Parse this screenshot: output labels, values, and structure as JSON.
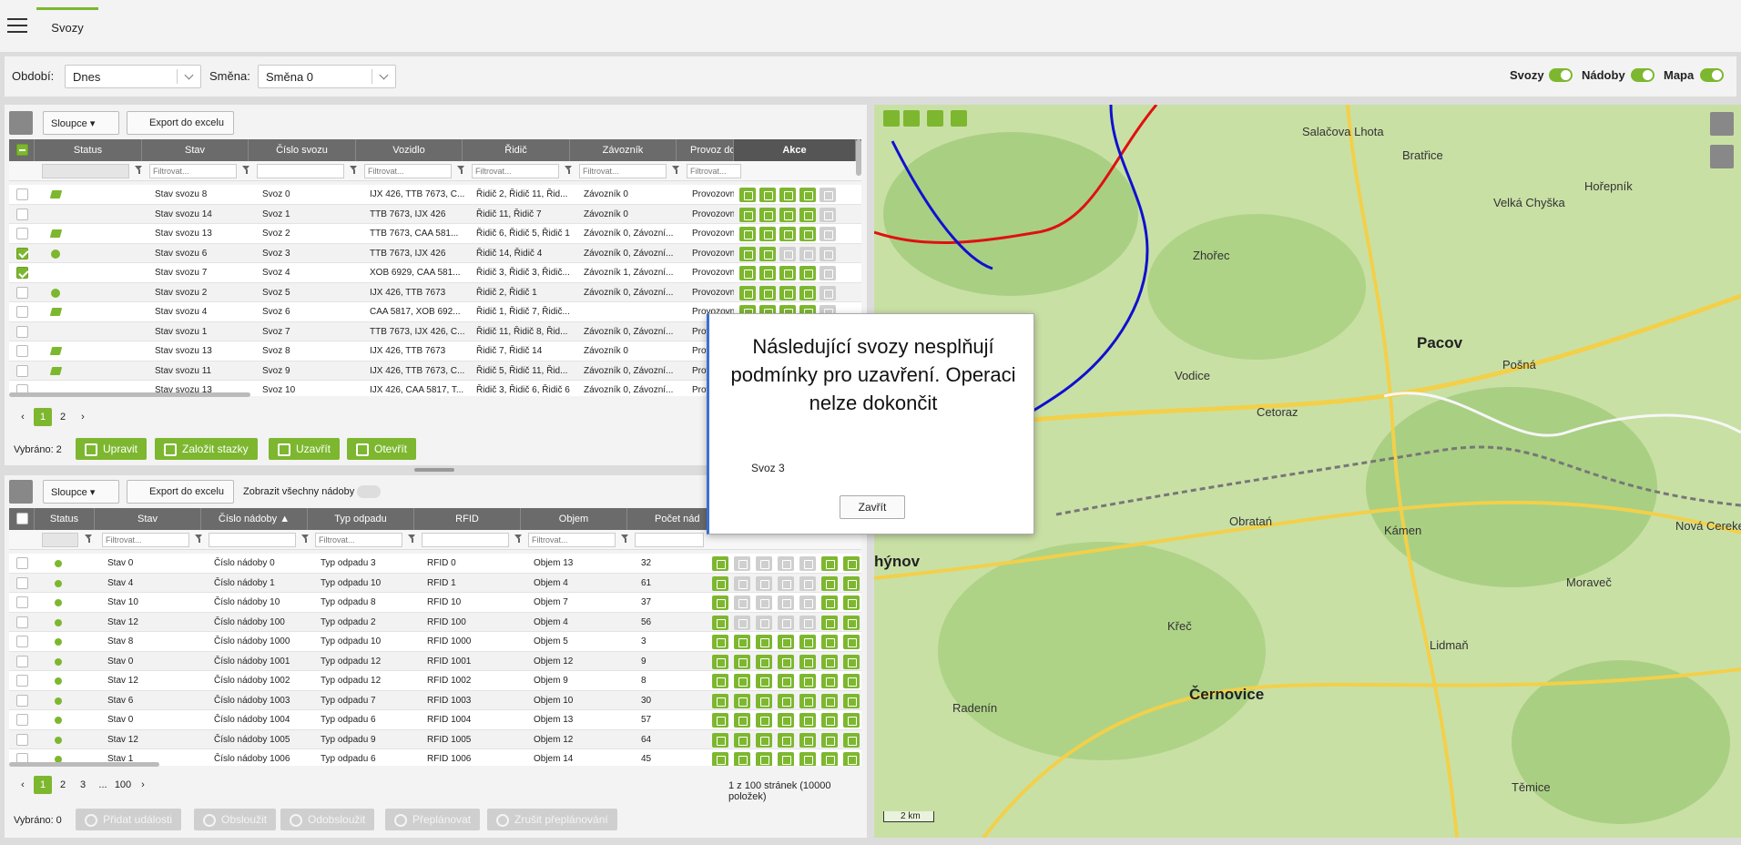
{
  "header": {
    "tab": "Svozy"
  },
  "filters": {
    "period_label": "Období:",
    "period_value": "Dnes",
    "shift_label": "Směna:",
    "shift_value": "Směna 0",
    "toggles": [
      {
        "label": "Svozy",
        "on": true
      },
      {
        "label": "Nádoby",
        "on": true
      },
      {
        "label": "Mapa",
        "on": true
      }
    ]
  },
  "top": {
    "columns_btn": "Sloupce",
    "export_btn": "Export do excelu",
    "headers": [
      "Status",
      "Stav",
      "Číslo svozu",
      "Vozidlo",
      "Řidič",
      "Závozník",
      "Provoz do",
      "Akce"
    ],
    "filter_placeholder": "Filtrovat...",
    "rows": [
      {
        "check": false,
        "icon": "truck",
        "stav": "Stav svozu 8",
        "svoz": "Svoz 0",
        "vozidlo": "IJX 426, TTB 7673, C...",
        "ridic": "Řidič 2, Řidič 11, Řid...",
        "zavoznik": "Závozník 0",
        "provoz": "Provozovna"
      },
      {
        "check": false,
        "icon": "",
        "stav": "Stav svozu 14",
        "svoz": "Svoz 1",
        "vozidlo": "TTB 7673, IJX 426",
        "ridic": "Řidič 11, Řidič 7",
        "zavoznik": "Závozník 0",
        "provoz": "Provozovna"
      },
      {
        "check": false,
        "icon": "truck",
        "stav": "Stav svozu 13",
        "svoz": "Svoz 2",
        "vozidlo": "TTB 7673, CAA 581...",
        "ridic": "Řidič 6, Řidič 5, Řidič 1",
        "zavoznik": "Závozník 0, Závozní...",
        "provoz": "Provozovna"
      },
      {
        "check": true,
        "icon": "ok",
        "stav": "Stav svozu 6",
        "svoz": "Svoz 3",
        "vozidlo": "TTB 7673, IJX 426",
        "ridic": "Řidič 14, Řidič 4",
        "zavoznik": "Závozník 0, Závozní...",
        "provoz": "Provozovna"
      },
      {
        "check": true,
        "icon": "",
        "stav": "Stav svozu 7",
        "svoz": "Svoz 4",
        "vozidlo": "XOB 6929, CAA 581...",
        "ridic": "Řidič 3, Řidič 3, Řidič...",
        "zavoznik": "Závozník 1, Závozní...",
        "provoz": "Provozovna"
      },
      {
        "check": false,
        "icon": "ok",
        "stav": "Stav svozu 2",
        "svoz": "Svoz 5",
        "vozidlo": "IJX 426, TTB 7673",
        "ridic": "Řidič 2, Řidič 1",
        "zavoznik": "Závozník 0, Závozní...",
        "provoz": "Provozovna"
      },
      {
        "check": false,
        "icon": "truck",
        "stav": "Stav svozu 4",
        "svoz": "Svoz 6",
        "vozidlo": "CAA 5817, XOB 692...",
        "ridic": "Řidič 1, Řidič 7, Řidič...",
        "zavoznik": "",
        "provoz": "Provozovna"
      },
      {
        "check": false,
        "icon": "",
        "stav": "Stav svozu 1",
        "svoz": "Svoz 7",
        "vozidlo": "TTB 7673, IJX 426, C...",
        "ridic": "Řidič 11, Řidič 8, Řid...",
        "zavoznik": "Závozník 0, Závozní...",
        "provoz": "Prov"
      },
      {
        "check": false,
        "icon": "truck",
        "stav": "Stav svozu 13",
        "svoz": "Svoz 8",
        "vozidlo": "IJX 426, TTB 7673",
        "ridic": "Řidič 7, Řidič 14",
        "zavoznik": "Závozník 0",
        "provoz": "Prov"
      },
      {
        "check": false,
        "icon": "truck",
        "stav": "Stav svozu 11",
        "svoz": "Svoz 9",
        "vozidlo": "IJX 426, TTB 7673, C...",
        "ridic": "Řidič 5, Řidič 11, Řid...",
        "zavoznik": "Závozník 0, Závozní...",
        "provoz": "Prov"
      },
      {
        "check": false,
        "icon": "",
        "stav": "Stav svozu 13",
        "svoz": "Svoz 10",
        "vozidlo": "IJX 426, CAA 5817, T...",
        "ridic": "Řidič 3, Řidič 6, Řidič 6",
        "zavoznik": "Závozník 0, Závozní...",
        "provoz": "Prov"
      }
    ],
    "pages": [
      "1",
      "2"
    ],
    "selected": "Vybráno: 2",
    "buttons": [
      "Upravit",
      "Založit stazky",
      "Uzavřít",
      "Otevřít"
    ]
  },
  "bottom": {
    "columns_btn": "Sloupce",
    "export_btn": "Export do excelu",
    "show_all": "Zobrazit všechny nádoby",
    "headers": [
      "Status",
      "Stav",
      "Číslo nádoby",
      "Typ odpadu",
      "RFID",
      "Objem",
      "Počet nád"
    ],
    "filter_placeholder": "Filtrovat...",
    "rows": [
      {
        "stav": "Stav 0",
        "cislo": "Číslo nádoby 0",
        "typ": "Typ odpadu 3",
        "rfid": "RFID 0",
        "objem": "Objem 13",
        "pocet": "32"
      },
      {
        "stav": "Stav 4",
        "cislo": "Číslo nádoby 1",
        "typ": "Typ odpadu 10",
        "rfid": "RFID 1",
        "objem": "Objem 4",
        "pocet": "61"
      },
      {
        "stav": "Stav 10",
        "cislo": "Číslo nádoby 10",
        "typ": "Typ odpadu 8",
        "rfid": "RFID 10",
        "objem": "Objem 7",
        "pocet": "37"
      },
      {
        "stav": "Stav 12",
        "cislo": "Číslo nádoby 100",
        "typ": "Typ odpadu 2",
        "rfid": "RFID 100",
        "objem": "Objem 4",
        "pocet": "56"
      },
      {
        "stav": "Stav 8",
        "cislo": "Číslo nádoby 1000",
        "typ": "Typ odpadu 10",
        "rfid": "RFID 1000",
        "objem": "Objem 5",
        "pocet": "3"
      },
      {
        "stav": "Stav 0",
        "cislo": "Číslo nádoby 1001",
        "typ": "Typ odpadu 12",
        "rfid": "RFID 1001",
        "objem": "Objem 12",
        "pocet": "9"
      },
      {
        "stav": "Stav 12",
        "cislo": "Číslo nádoby 1002",
        "typ": "Typ odpadu 12",
        "rfid": "RFID 1002",
        "objem": "Objem 9",
        "pocet": "8"
      },
      {
        "stav": "Stav 6",
        "cislo": "Číslo nádoby 1003",
        "typ": "Typ odpadu 7",
        "rfid": "RFID 1003",
        "objem": "Objem 10",
        "pocet": "30"
      },
      {
        "stav": "Stav 0",
        "cislo": "Číslo nádoby 1004",
        "typ": "Typ odpadu 6",
        "rfid": "RFID 1004",
        "objem": "Objem 13",
        "pocet": "57"
      },
      {
        "stav": "Stav 12",
        "cislo": "Číslo nádoby 1005",
        "typ": "Typ odpadu 9",
        "rfid": "RFID 1005",
        "objem": "Objem 12",
        "pocet": "64"
      },
      {
        "stav": "Stav 1",
        "cislo": "Číslo nádoby 1006",
        "typ": "Typ odpadu 6",
        "rfid": "RFID 1006",
        "objem": "Objem 14",
        "pocet": "45"
      }
    ],
    "pages": [
      "1",
      "2",
      "3",
      "...",
      "100"
    ],
    "page_info": "1 z 100 stránek (10000 položek)",
    "selected": "Vybráno: 0",
    "buttons": [
      "Přidat události",
      "Obsloužit",
      "Odobsloužit",
      "Přeplánovat",
      "Zrušit přeplánování"
    ]
  },
  "modal": {
    "title": "Následující svozy nesplňují podmínky pro uzavření. Operaci nelze dokončit",
    "text": "Svoz 3",
    "close": "Zavřít"
  },
  "map": {
    "places": [
      {
        "n": "Salačova Lhota",
        "big": false
      },
      {
        "n": "Bratřice",
        "big": false
      },
      {
        "n": "Hořepník",
        "big": false
      },
      {
        "n": "Velká Chyška",
        "big": false
      },
      {
        "n": "Zhořec",
        "big": false
      },
      {
        "n": "Pacov",
        "big": true
      },
      {
        "n": "Pošná",
        "big": false
      },
      {
        "n": "Vodice",
        "big": false
      },
      {
        "n": "Cetoraz",
        "big": false
      },
      {
        "n": "Obratań",
        "big": false
      },
      {
        "n": "Kámen",
        "big": false
      },
      {
        "n": "Nová Cerekev",
        "big": false
      },
      {
        "n": "Moraveč",
        "big": false
      },
      {
        "n": "Křeč",
        "big": false
      },
      {
        "n": "Lidmaň",
        "big": false
      },
      {
        "n": "Černovice",
        "big": true
      },
      {
        "n": "Radenín",
        "big": false
      },
      {
        "n": "Těmice",
        "big": false
      },
      {
        "n": "hýnov",
        "big": true
      }
    ],
    "scale": "2 km",
    "colors": {
      "route_red": "#e01010",
      "route_blue": "#1010d0",
      "accent": "#7db72f"
    }
  }
}
